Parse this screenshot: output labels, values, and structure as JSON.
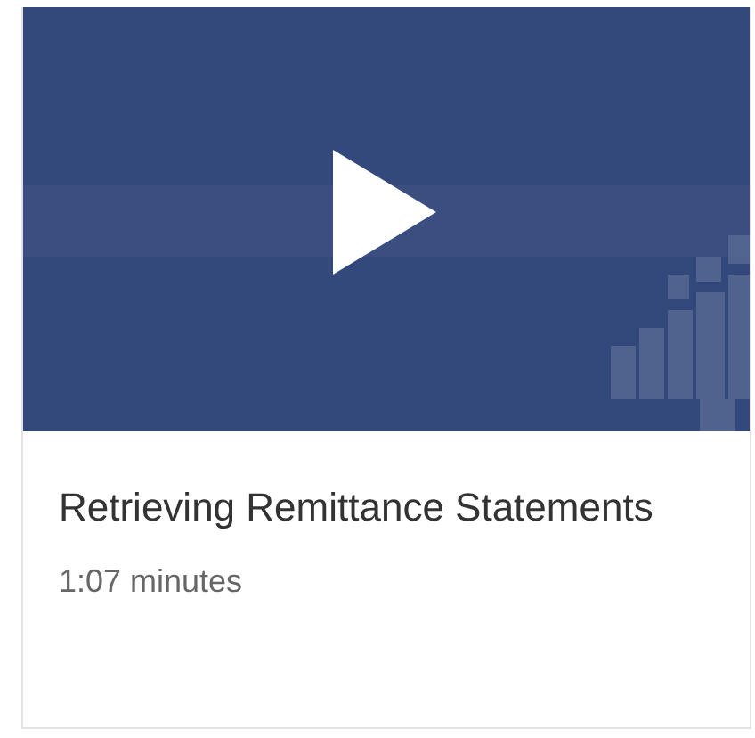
{
  "video": {
    "title": "Retrieving Remittance Statements",
    "duration": "1:07 minutes"
  }
}
